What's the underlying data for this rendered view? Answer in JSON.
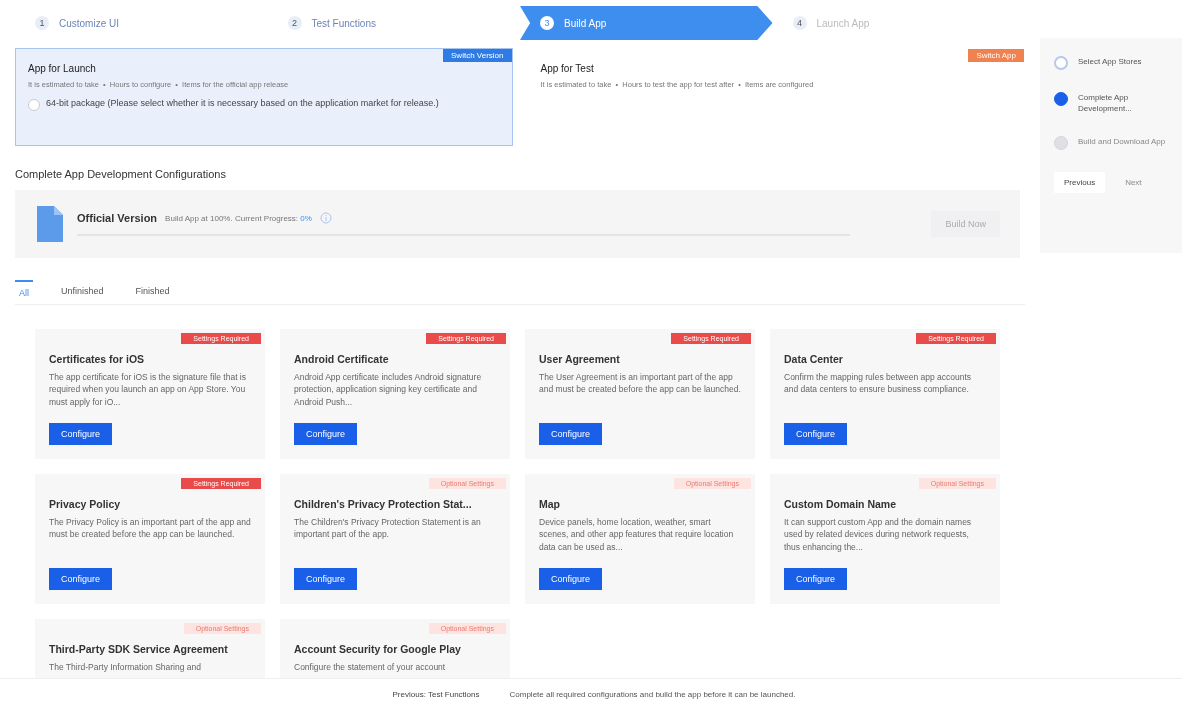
{
  "steps": [
    {
      "number": "1",
      "label": "Customize UI",
      "selected": false
    },
    {
      "number": "2",
      "label": "Test Functions",
      "selected": false
    },
    {
      "number": "3",
      "label": "Build App",
      "selected": true
    },
    {
      "number": "4",
      "label": "Launch App",
      "selected": false
    }
  ],
  "app_types": [
    {
      "title": "App for Launch",
      "badge": "Switch Version",
      "kind": "launch",
      "meta": "It is estimated to take  •  Hours to configure  •  Items for the official app release",
      "selected": true,
      "checkbox": {
        "label": "64-bit package (Please select whether it is necessary based on the application market for release.)",
        "checked": false
      }
    },
    {
      "title": "App for Test",
      "badge": "Switch App",
      "kind": "test",
      "meta": "It is estimated to take  •  Hours to test the app for test after  •  Items are configured",
      "selected": false
    }
  ],
  "section_title": "Complete App Development Configurations",
  "build": {
    "title": "Official Version",
    "info": "Build App at 100%. Current Progress:",
    "progress": "0%",
    "level": 0,
    "button": "Build Now"
  },
  "tabs": [
    {
      "label": "All",
      "selected": true
    },
    {
      "label": "Unfinished",
      "selected": false
    },
    {
      "label": "Finished",
      "selected": false
    }
  ],
  "configs": [
    {
      "title": "Certificates for iOS",
      "badge": "Settings Required",
      "required": true,
      "desc": "The app certificate for iOS is the signature file that is required when you launch an app on App Store. You must apply for iO...",
      "button": "Configure"
    },
    {
      "title": "Android Certificate",
      "badge": "Settings Required",
      "required": true,
      "desc": "Android App certificate includes Android signature protection, application signing key certificate and Android Push...",
      "button": "Configure"
    },
    {
      "title": "User Agreement",
      "badge": "Settings Required",
      "required": true,
      "desc": "The User Agreement is an important part of the app and must be created before the app can be launched.",
      "button": "Configure"
    },
    {
      "title": "Data Center",
      "badge": "Settings Required",
      "required": true,
      "desc": "Confirm the mapping rules between app accounts and data centers to ensure business compliance.",
      "button": "Configure"
    },
    {
      "title": "Privacy Policy",
      "badge": "Settings Required",
      "required": true,
      "desc": "The Privacy Policy is an important part of the app and must be created before the app can be launched.",
      "button": "Configure"
    },
    {
      "title": "Children's Privacy Protection Stat...",
      "badge": "Optional Settings",
      "required": false,
      "desc": "The Children's Privacy Protection Statement is an important part of the app.",
      "button": "Configure"
    },
    {
      "title": "Map",
      "badge": "Optional Settings",
      "required": false,
      "desc": "Device panels, home location, weather, smart scenes, and other app features that require location data can be used as...",
      "button": "Configure"
    },
    {
      "title": "Custom Domain Name",
      "badge": "Optional Settings",
      "required": false,
      "desc": "It can support custom App and the domain names used by related devices during network requests, thus enhancing the...",
      "button": "Configure"
    },
    {
      "title": "Third-Party SDK Service Agreement",
      "badge": "Optional Settings",
      "required": false,
      "desc": "The Third-Party Information Sharing and"
    },
    {
      "title": "Account Security for Google Play",
      "badge": "Optional Settings",
      "required": false,
      "desc": "Configure the statement of your account"
    }
  ],
  "side_steps": [
    {
      "label": "Select App Stores",
      "completed": true,
      "selected": false
    },
    {
      "label": "Complete App Development...",
      "completed": false,
      "selected": true
    },
    {
      "label": "Build and Download App",
      "completed": false,
      "selected": false
    }
  ],
  "side_buttons": [
    {
      "label": "Previous",
      "disabled": false
    },
    {
      "label": "Next",
      "disabled": true
    }
  ],
  "footer": {
    "button": "Previous: Test Functions",
    "message": "Complete all required configurations and build the app before it can be launched."
  }
}
